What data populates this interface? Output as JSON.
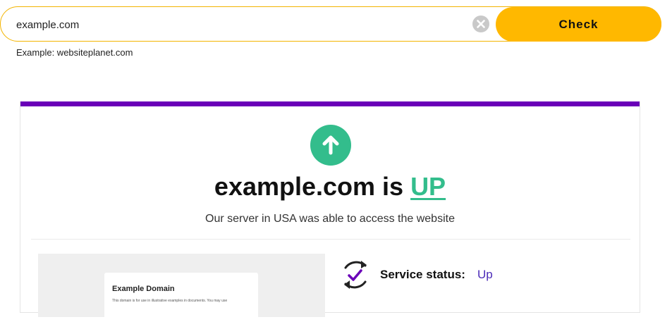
{
  "search": {
    "value": "example.com",
    "hint": "Example: websiteplanet.com",
    "check_label": "Check"
  },
  "result": {
    "domain_text": "example.com is ",
    "status_word": "UP",
    "message": "Our server in USA was able to access the website",
    "preview": {
      "title": "Example Domain",
      "text": "This domain is for use in illustrative examples in documents. You may use"
    },
    "service_label": "Service status:",
    "service_value": "Up"
  },
  "colors": {
    "accent_yellow": "#ffb800",
    "up_green": "#33bd8c",
    "top_bar_purple": "#6a00b8",
    "status_value_purple": "#4b2bb8"
  },
  "icons": {
    "clear": "clear-icon",
    "status": "arrow-up-icon",
    "service": "sync-check-icon"
  }
}
